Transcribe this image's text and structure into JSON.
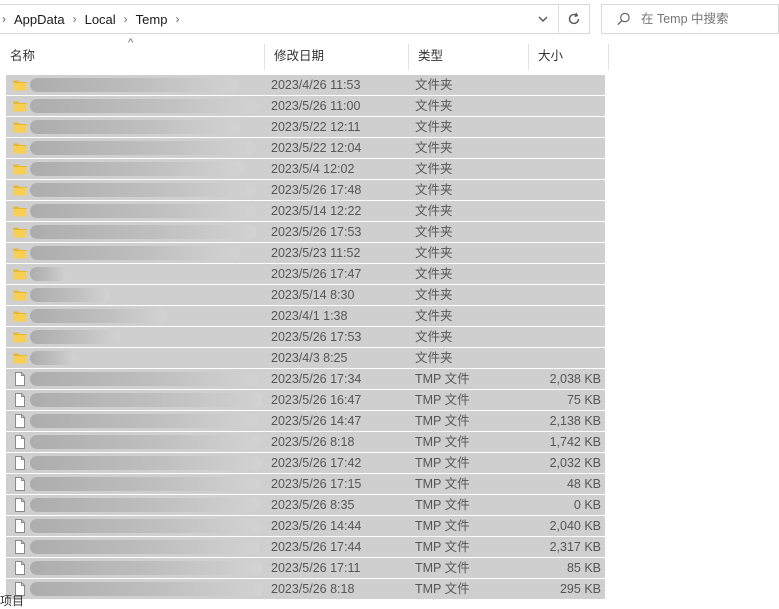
{
  "address": {
    "crumbs": [
      "AppData",
      "Local",
      "Temp"
    ],
    "search_placeholder": "在 Temp 中搜索"
  },
  "columns": {
    "name": "名称",
    "date": "修改日期",
    "type": "类型",
    "size": "大小"
  },
  "status": {
    "text": "项目"
  },
  "rows": [
    {
      "kind": "folder",
      "name": "",
      "date": "2023/4/26 11:53",
      "type": "文件夹",
      "size": ""
    },
    {
      "kind": "folder",
      "name": "",
      "date": "2023/5/26 11:00",
      "type": "文件夹",
      "size": ""
    },
    {
      "kind": "folder",
      "name": "",
      "date": "2023/5/22 12:11",
      "type": "文件夹",
      "size": ""
    },
    {
      "kind": "folder",
      "name": "",
      "date": "2023/5/22 12:04",
      "type": "文件夹",
      "size": ""
    },
    {
      "kind": "folder",
      "name": "",
      "date": "2023/5/4 12:02",
      "type": "文件夹",
      "size": ""
    },
    {
      "kind": "folder",
      "name": "",
      "date": "2023/5/26 17:48",
      "type": "文件夹",
      "size": ""
    },
    {
      "kind": "folder",
      "name": "",
      "date": "2023/5/14 12:22",
      "type": "文件夹",
      "size": ""
    },
    {
      "kind": "folder",
      "name": "",
      "date": "2023/5/26 17:53",
      "type": "文件夹",
      "size": ""
    },
    {
      "kind": "folder",
      "name": "",
      "date": "2023/5/23 11:52",
      "type": "文件夹",
      "size": ""
    },
    {
      "kind": "folder",
      "name": "",
      "date": "2023/5/26 17:47",
      "type": "文件夹",
      "size": ""
    },
    {
      "kind": "folder",
      "name": "",
      "date": "2023/5/14 8:30",
      "type": "文件夹",
      "size": ""
    },
    {
      "kind": "folder",
      "name": "",
      "date": "2023/4/1 1:38",
      "type": "文件夹",
      "size": ""
    },
    {
      "kind": "folder",
      "name": "",
      "date": "2023/5/26 17:53",
      "type": "文件夹",
      "size": ""
    },
    {
      "kind": "folder",
      "name": "",
      "date": "2023/4/3 8:25",
      "type": "文件夹",
      "size": ""
    },
    {
      "kind": "file",
      "name": "",
      "date": "2023/5/26 17:34",
      "type": "TMP 文件",
      "size": "2,038 KB"
    },
    {
      "kind": "file",
      "name": "",
      "date": "2023/5/26 16:47",
      "type": "TMP 文件",
      "size": "75 KB"
    },
    {
      "kind": "file",
      "name": "",
      "date": "2023/5/26 14:47",
      "type": "TMP 文件",
      "size": "2,138 KB"
    },
    {
      "kind": "file",
      "name": "",
      "date": "2023/5/26 8:18",
      "type": "TMP 文件",
      "size": "1,742 KB"
    },
    {
      "kind": "file",
      "name": "",
      "date": "2023/5/26 17:42",
      "type": "TMP 文件",
      "size": "2,032 KB"
    },
    {
      "kind": "file",
      "name": "",
      "date": "2023/5/26 17:15",
      "type": "TMP 文件",
      "size": "48 KB"
    },
    {
      "kind": "file",
      "name": "",
      "date": "2023/5/26 8:35",
      "type": "TMP 文件",
      "size": "0 KB"
    },
    {
      "kind": "file",
      "name": "",
      "date": "2023/5/26 14:44",
      "type": "TMP 文件",
      "size": "2,040 KB"
    },
    {
      "kind": "file",
      "name": "",
      "date": "2023/5/26 17:44",
      "type": "TMP 文件",
      "size": "2,317 KB"
    },
    {
      "kind": "file",
      "name": "",
      "date": "2023/5/26 17:11",
      "type": "TMP 文件",
      "size": "85 KB"
    },
    {
      "kind": "file",
      "name": "",
      "date": "2023/5/26 8:18",
      "type": "TMP 文件",
      "size": "295 KB"
    }
  ]
}
